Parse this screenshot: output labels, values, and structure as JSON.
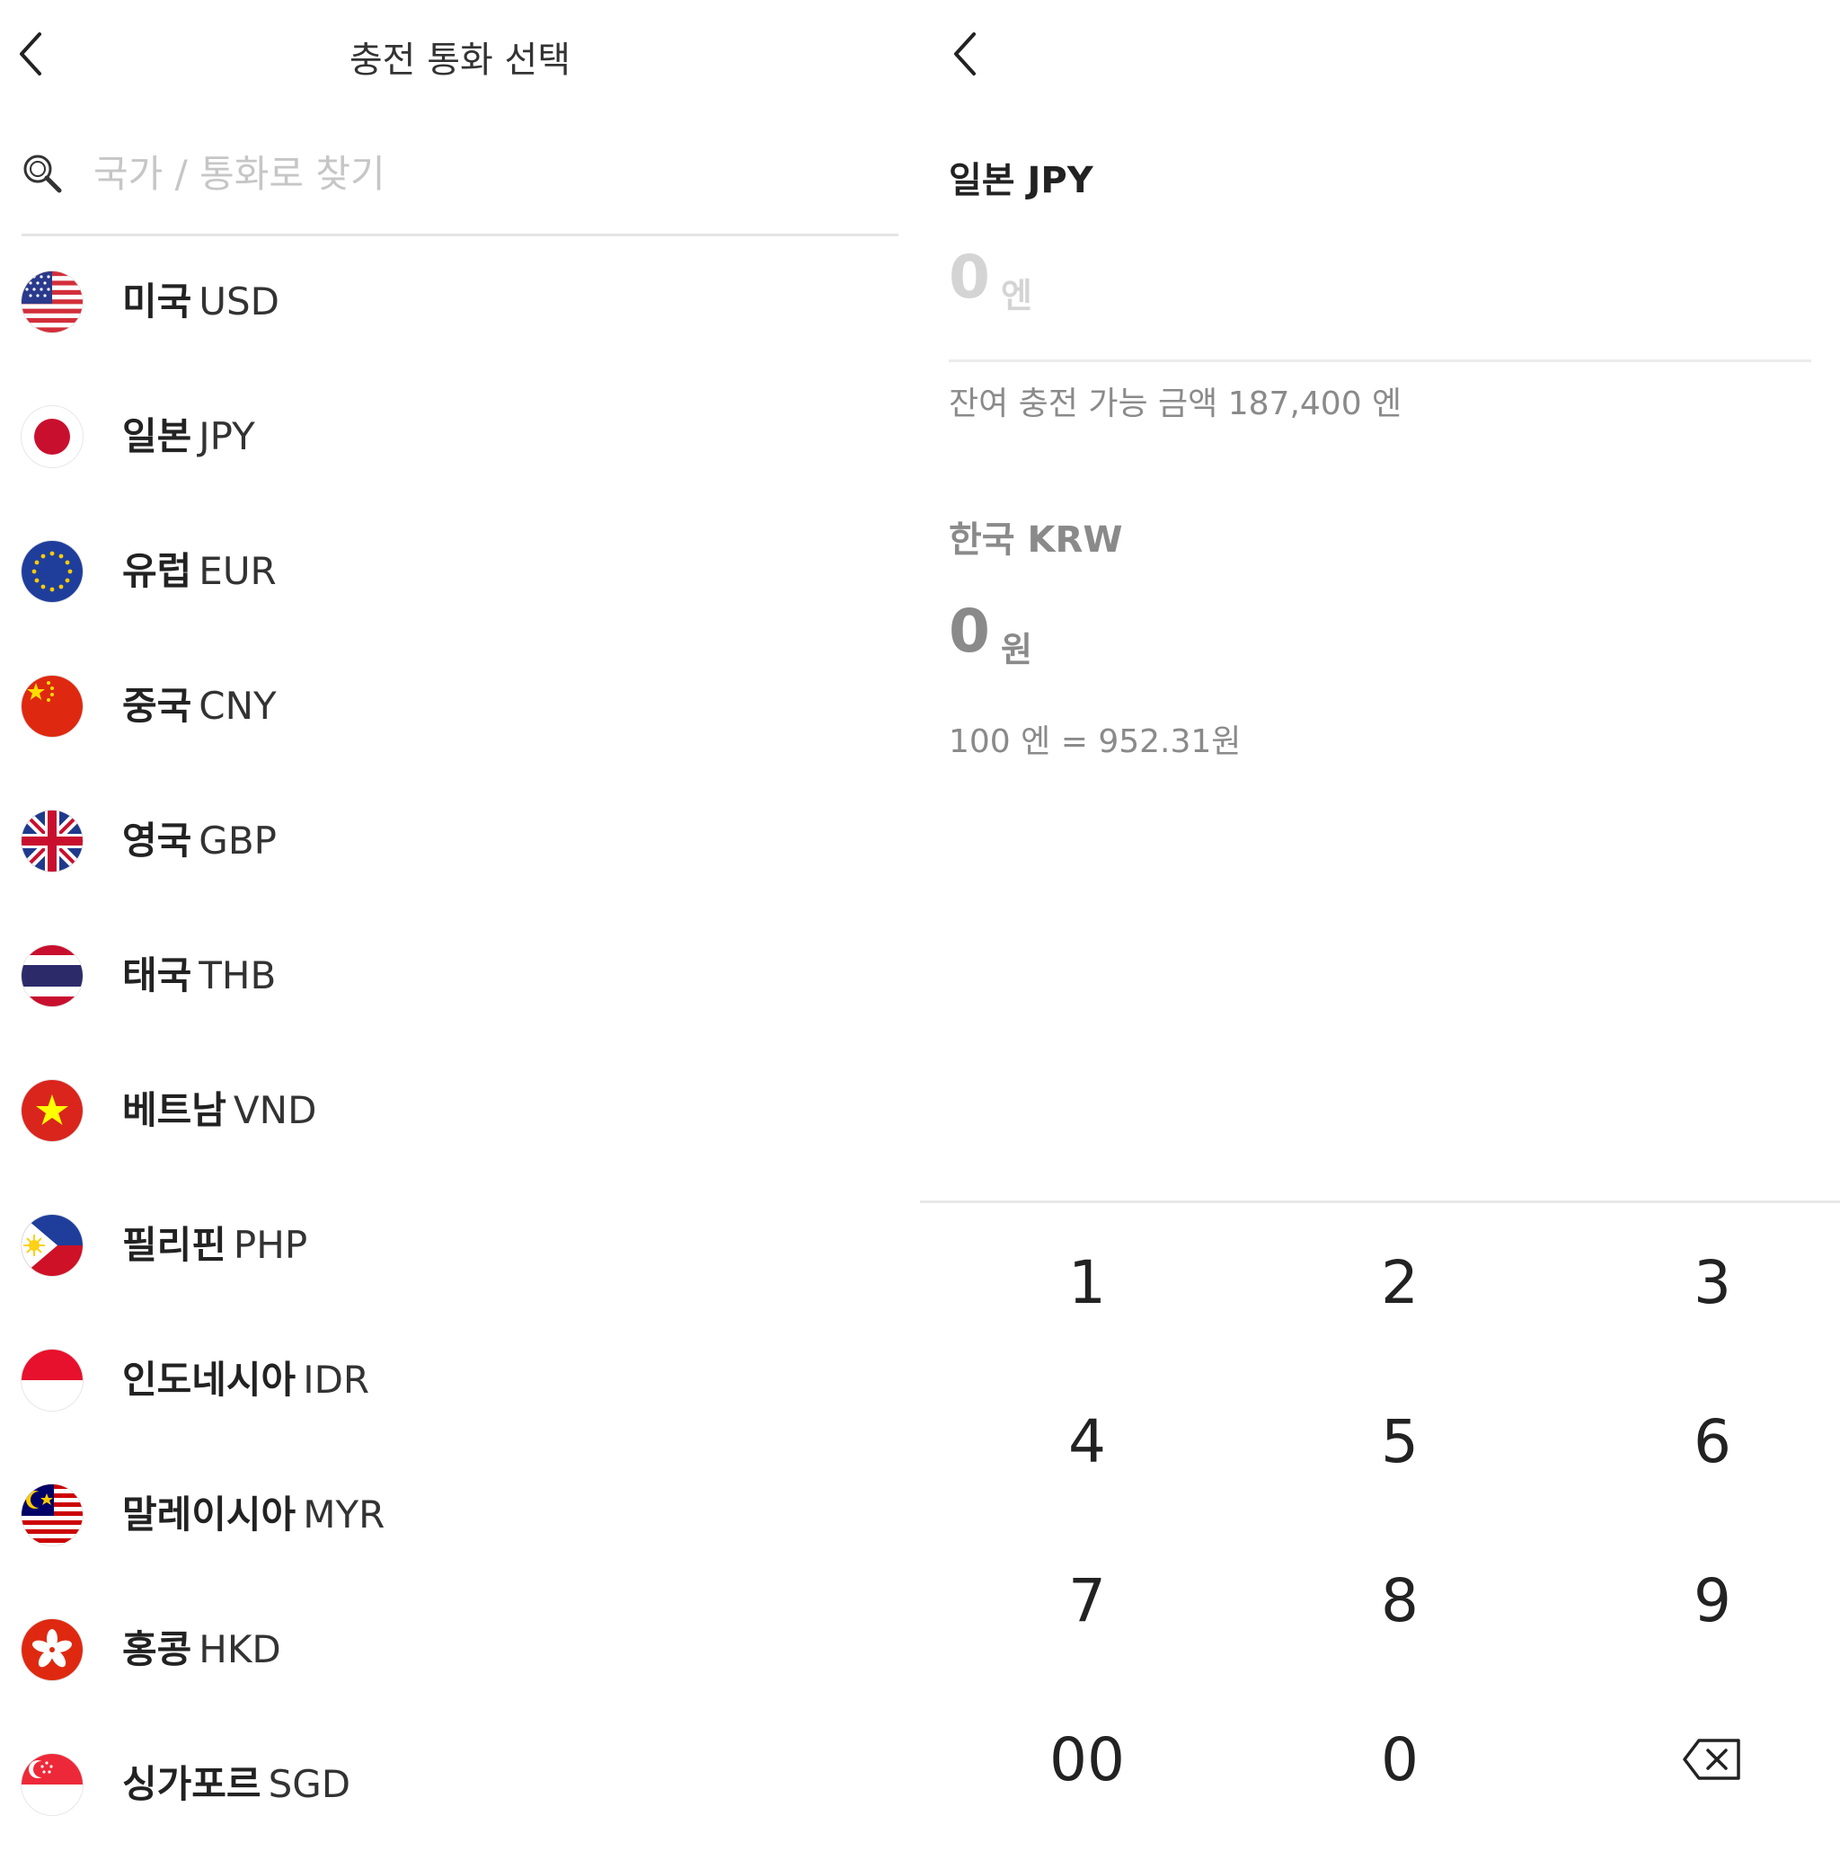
{
  "left": {
    "title": "충전 통화 선택",
    "search_placeholder": "국가 / 통화로 찾기",
    "currencies": [
      {
        "name": "미국",
        "code": "USD",
        "flag": "us-flag-icon"
      },
      {
        "name": "일본",
        "code": "JPY",
        "flag": "jp-flag-icon"
      },
      {
        "name": "유럽",
        "code": "EUR",
        "flag": "eu-flag-icon"
      },
      {
        "name": "중국",
        "code": "CNY",
        "flag": "cn-flag-icon"
      },
      {
        "name": "영국",
        "code": "GBP",
        "flag": "gb-flag-icon"
      },
      {
        "name": "태국",
        "code": "THB",
        "flag": "th-flag-icon"
      },
      {
        "name": "베트남",
        "code": "VND",
        "flag": "vn-flag-icon"
      },
      {
        "name": "필리핀",
        "code": "PHP",
        "flag": "ph-flag-icon"
      },
      {
        "name": "인도네시아",
        "code": "IDR",
        "flag": "id-flag-icon"
      },
      {
        "name": "말레이시아",
        "code": "MYR",
        "flag": "my-flag-icon"
      },
      {
        "name": "홍콩",
        "code": "HKD",
        "flag": "hk-flag-icon"
      },
      {
        "name": "싱가포르",
        "code": "SGD",
        "flag": "sg-flag-icon"
      }
    ]
  },
  "right": {
    "foreign_title": "일본 JPY",
    "foreign_amount": "0",
    "foreign_unit": "엔",
    "remaining_text": "잔여 충전 가능 금액 187,400 엔",
    "krw_title": "한국 KRW",
    "krw_amount": "0",
    "krw_unit": "원",
    "rate_text": "100 엔 = 952.31원",
    "keypad": [
      "1",
      "2",
      "3",
      "4",
      "5",
      "6",
      "7",
      "8",
      "9",
      "00",
      "0",
      "backspace"
    ]
  },
  "colors": {
    "text_primary": "#222222",
    "text_secondary": "#8a8a8a",
    "placeholder": "#c6c6c6",
    "divider": "#e8e8e8"
  }
}
